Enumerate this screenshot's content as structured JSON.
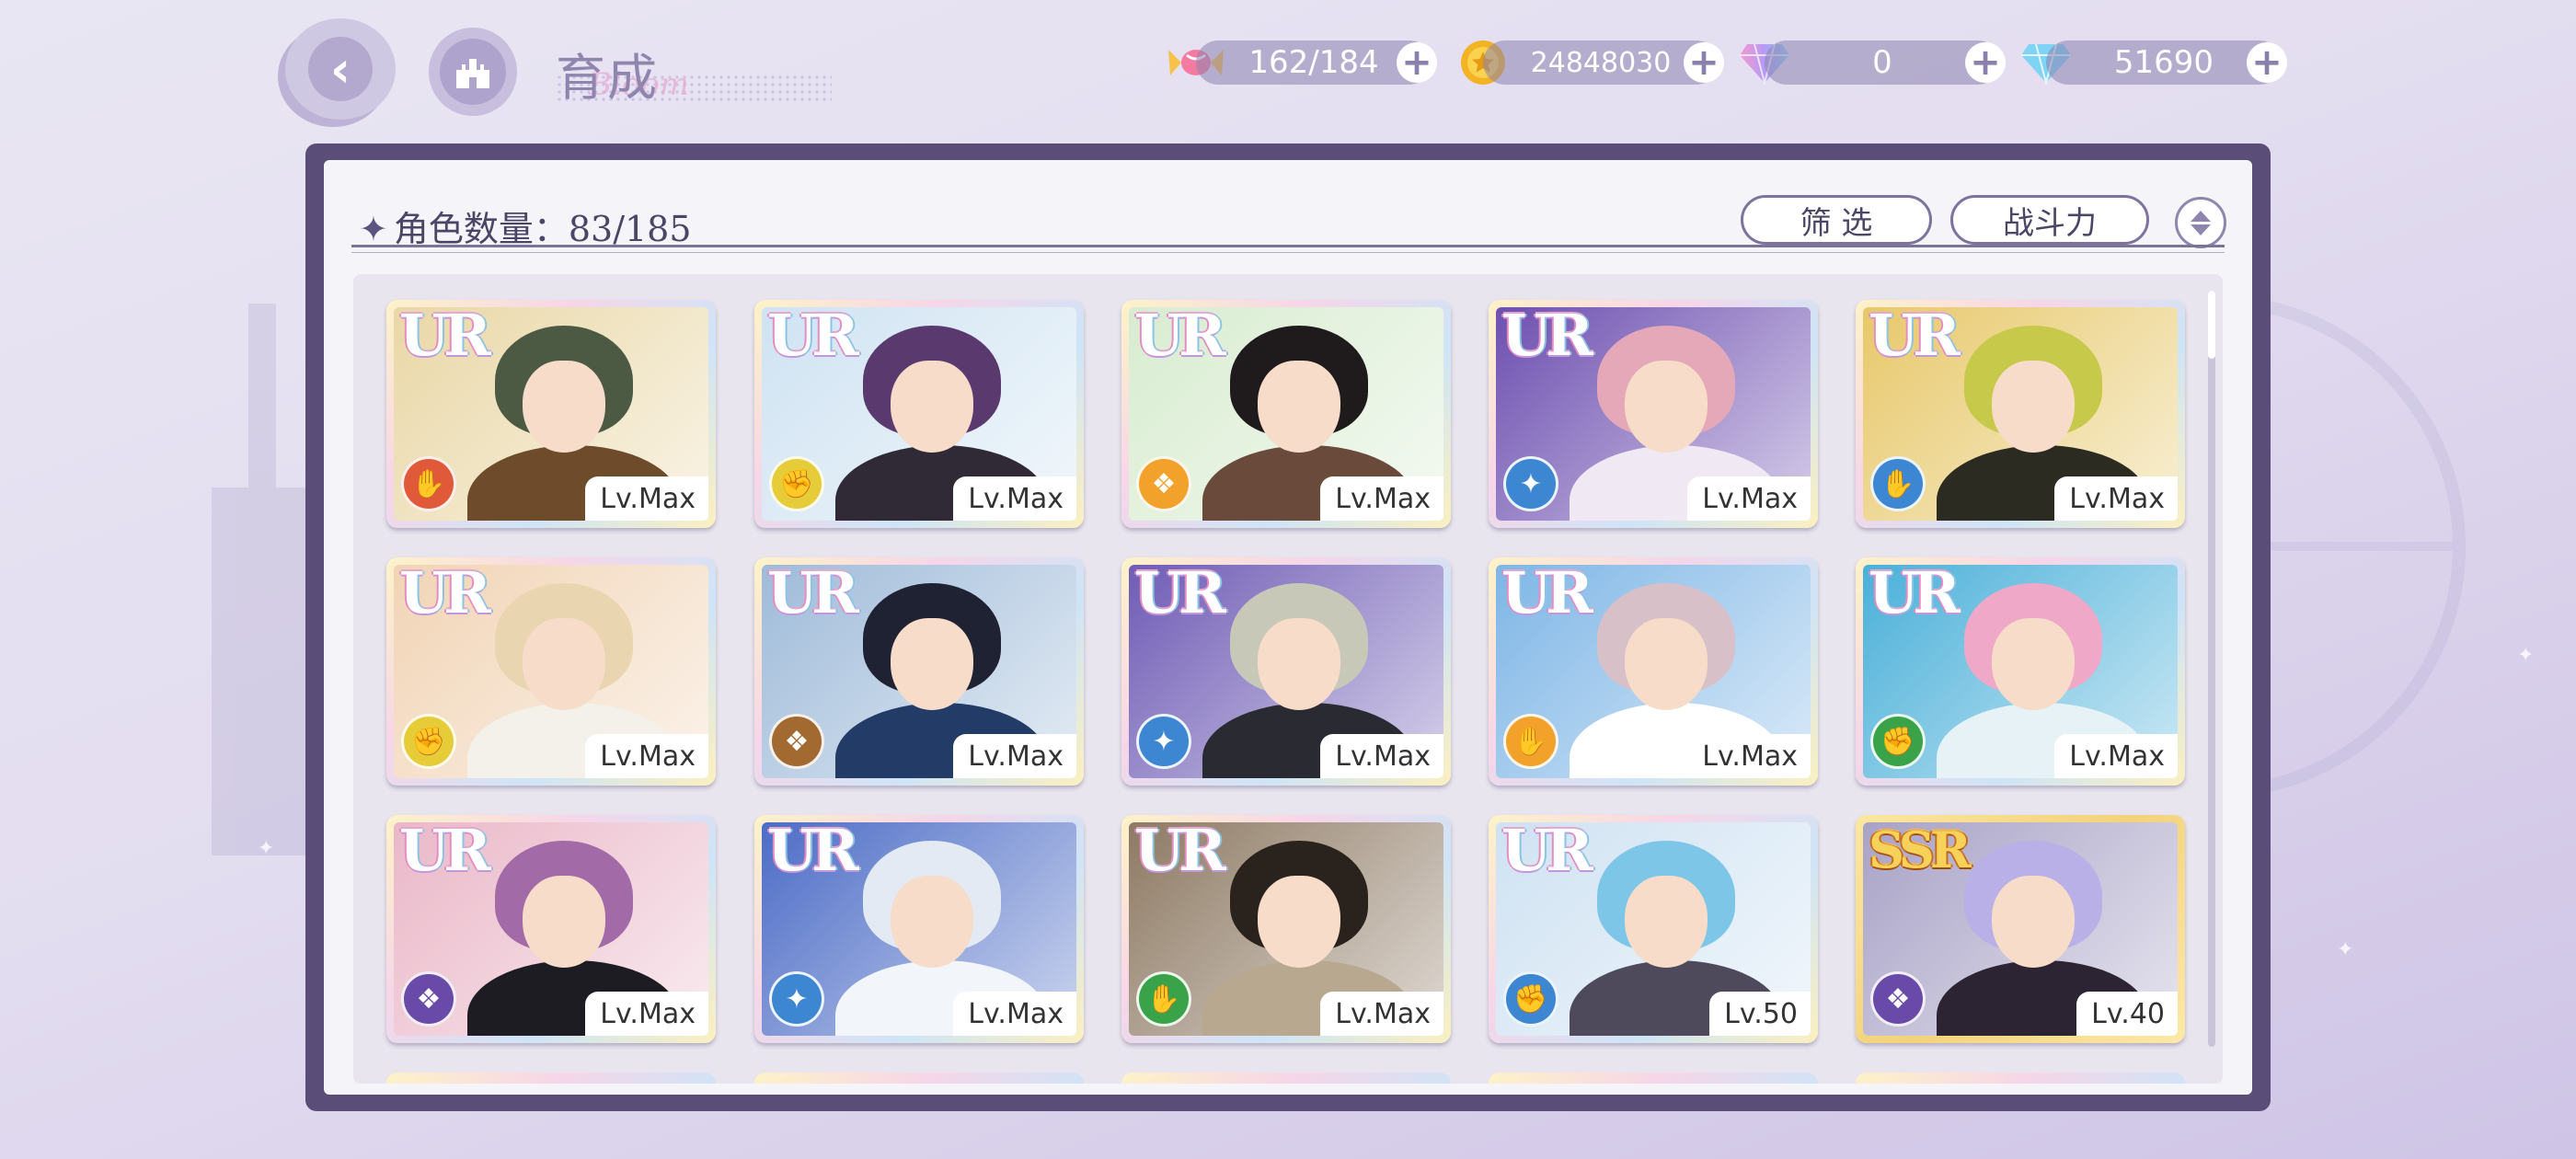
{
  "header": {
    "title": "育成",
    "title_script": "Bloom",
    "back_label": "返回",
    "home_label": "主页"
  },
  "resources": [
    {
      "name": "stamina",
      "icon": "candy-icon",
      "value": "162/184"
    },
    {
      "name": "coin",
      "icon": "coin-icon",
      "value": "24848030"
    },
    {
      "name": "paid-gem",
      "icon": "rainbow-gem-icon",
      "value": "0"
    },
    {
      "name": "gem",
      "icon": "diamond-icon",
      "value": "51690"
    }
  ],
  "panel": {
    "count_label": "角色数量：83/185",
    "filter_label": "筛 选",
    "sort_label": "战斗力"
  },
  "cards": [
    {
      "rarity": "UR",
      "level": "Lv.Max",
      "attr_color": "#e05a3a",
      "hair": "#4c5a44",
      "outfit": "#6e4b2a",
      "bg": "#e9d7a6"
    },
    {
      "rarity": "UR",
      "level": "Lv.Max",
      "attr_color": "#e6cc38",
      "hair": "#5a3a6e",
      "outfit": "#2f2a35",
      "bg": "#cfe3f2"
    },
    {
      "rarity": "UR",
      "level": "Lv.Max",
      "attr_color": "#f2a12a",
      "hair": "#1f1a1c",
      "outfit": "#6a4a3a",
      "bg": "#d8ecd0"
    },
    {
      "rarity": "UR",
      "level": "Lv.Max",
      "attr_color": "#3c86d2",
      "hair": "#e4a8b8",
      "outfit": "#f0e8f2",
      "bg": "#6d4fb0"
    },
    {
      "rarity": "UR",
      "level": "Lv.Max",
      "attr_color": "#3c86d2",
      "hair": "#c7c94a",
      "outfit": "#2b2b22",
      "bg": "#e7c86a"
    },
    {
      "rarity": "UR",
      "level": "Lv.Max",
      "attr_color": "#e6cc38",
      "hair": "#e9d6b0",
      "outfit": "#f4f0ea",
      "bg": "#f1d4b5"
    },
    {
      "rarity": "UR",
      "level": "Lv.Max",
      "attr_color": "#a26a30",
      "hair": "#1e2233",
      "outfit": "#223b67",
      "bg": "#9fbbd9"
    },
    {
      "rarity": "UR",
      "level": "Lv.Max",
      "attr_color": "#3c86d2",
      "hair": "#c8c8b8",
      "outfit": "#2a2a33",
      "bg": "#6f5cb5"
    },
    {
      "rarity": "UR",
      "level": "Lv.Max",
      "attr_color": "#f2a12a",
      "hair": "#d8c0c8",
      "outfit": "#ffffff",
      "bg": "#7eb6e6"
    },
    {
      "rarity": "UR",
      "level": "Lv.Max",
      "attr_color": "#3aa34a",
      "hair": "#f0a8c8",
      "outfit": "#e6f2f6",
      "bg": "#4ab0d9"
    },
    {
      "rarity": "UR",
      "level": "Lv.Max",
      "attr_color": "#6a4aa8",
      "hair": "#a36aa8",
      "outfit": "#1c1c22",
      "bg": "#eab8c8"
    },
    {
      "rarity": "UR",
      "level": "Lv.Max",
      "attr_color": "#3c86d2",
      "hair": "#e4eaf4",
      "outfit": "#f2f6fa",
      "bg": "#4c6cc6"
    },
    {
      "rarity": "UR",
      "level": "Lv.Max",
      "attr_color": "#3aa34a",
      "hair": "#2a221c",
      "outfit": "#b8a890",
      "bg": "#8e7a64"
    },
    {
      "rarity": "UR",
      "level": "Lv.50",
      "attr_color": "#3c86d2",
      "hair": "#7ec6e8",
      "outfit": "#4e4a5c",
      "bg": "#cfe2f2"
    },
    {
      "rarity": "SSR",
      "level": "Lv.40",
      "attr_color": "#6a4aa8",
      "hair": "#b8b0e6",
      "outfit": "#2c2432",
      "bg": "#a8a2c6"
    }
  ]
}
